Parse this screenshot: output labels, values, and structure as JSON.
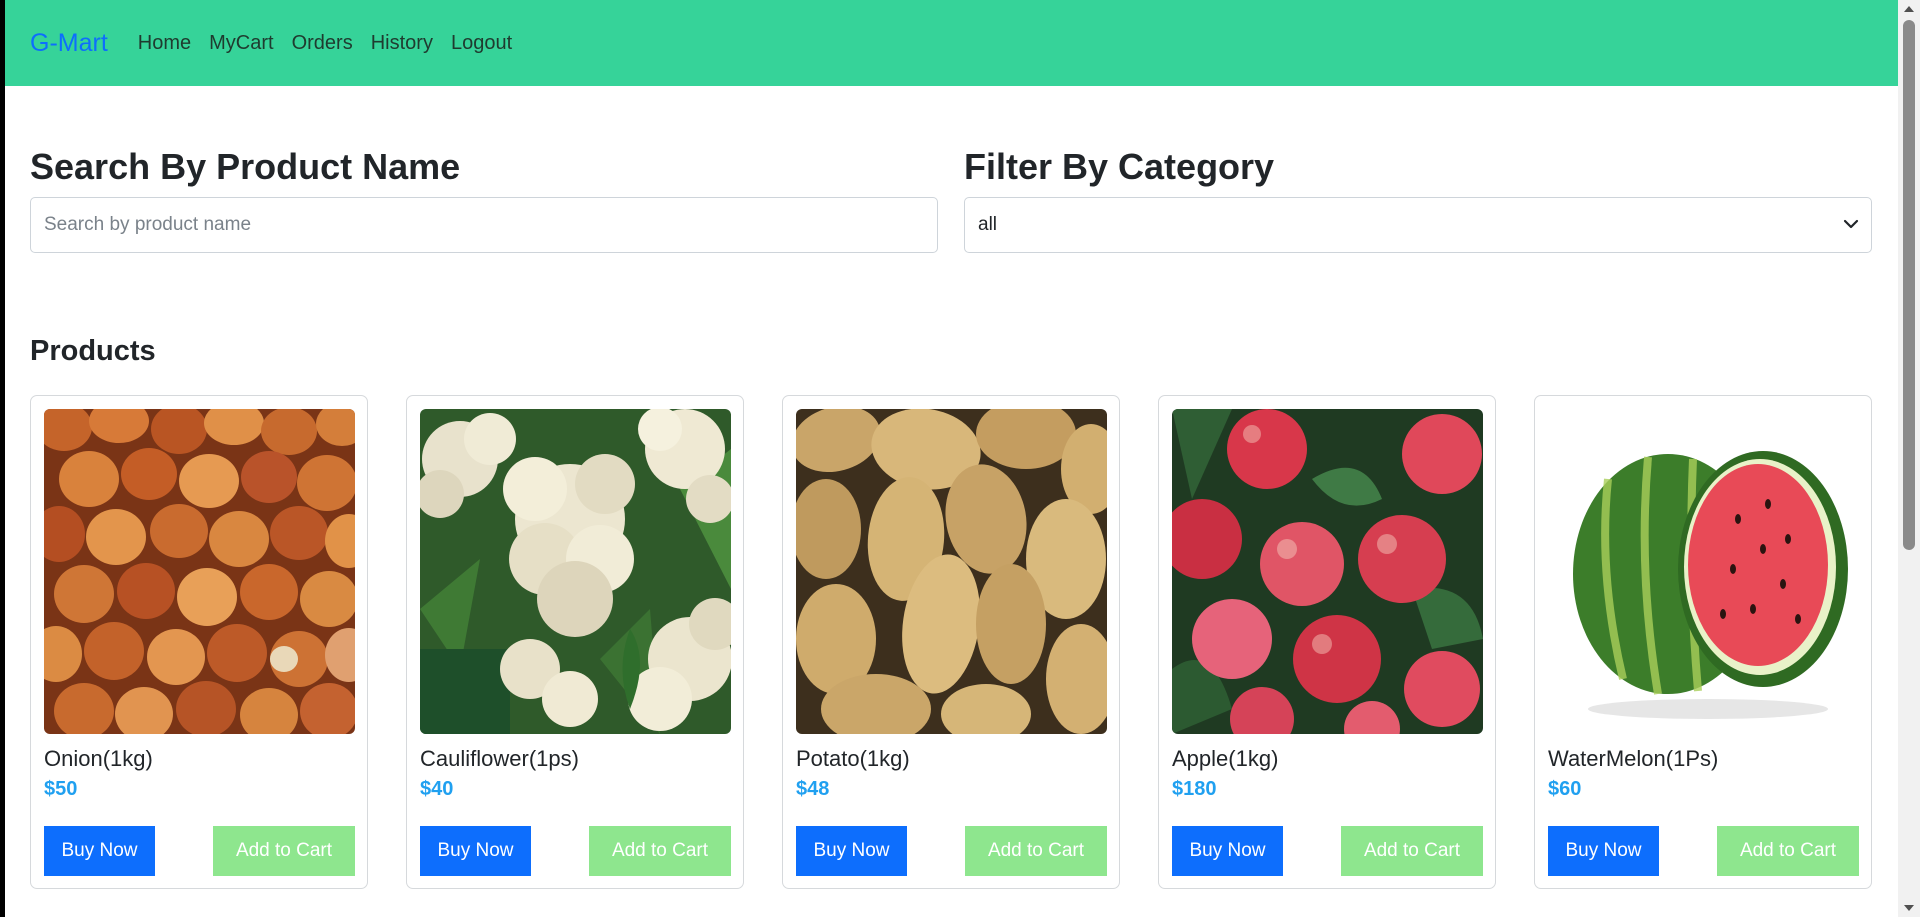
{
  "navbar": {
    "brand": "G-Mart",
    "links": [
      "Home",
      "MyCart",
      "Orders",
      "History",
      "Logout"
    ],
    "background": "#36d399",
    "brand_color": "#0d6efd"
  },
  "search": {
    "title": "Search By Product Name",
    "placeholder": "Search by product name"
  },
  "filter": {
    "title": "Filter By Category",
    "selected": "all"
  },
  "products": {
    "title": "Products",
    "items": [
      {
        "name": "Onion(1kg)",
        "price": "$50",
        "image": "onions-photo",
        "buy_label": "Buy Now",
        "cart_label": "Add to Cart"
      },
      {
        "name": "Cauliflower(1ps)",
        "price": "$40",
        "image": "cauliflower-photo",
        "buy_label": "Buy Now",
        "cart_label": "Add to Cart"
      },
      {
        "name": "Potato(1kg)",
        "price": "$48",
        "image": "potatoes-photo",
        "buy_label": "Buy Now",
        "cart_label": "Add to Cart"
      },
      {
        "name": "Apple(1kg)",
        "price": "$180",
        "image": "apples-photo",
        "buy_label": "Buy Now",
        "cart_label": "Add to Cart"
      },
      {
        "name": "WaterMelon(1Ps)",
        "price": "$60",
        "image": "watermelon-photo",
        "buy_label": "Buy Now",
        "cart_label": "Add to Cart"
      }
    ]
  },
  "colors": {
    "buy_button": "#0d6efd",
    "cart_button": "#8ee68e",
    "price": "#20a0f0"
  }
}
